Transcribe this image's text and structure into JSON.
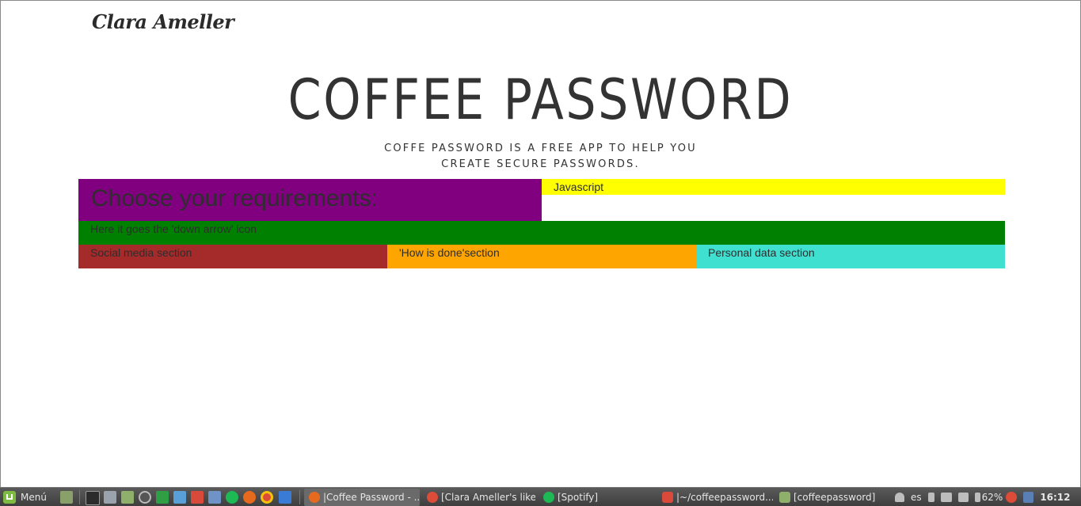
{
  "site": {
    "brand": "Clara Ameller",
    "title": "COFFEE PASSWORD",
    "subtitle_line1": "COFFE PASSWORD IS A FREE APP TO HELP YOU",
    "subtitle_line2": "CREATE SECURE PASSWORDS."
  },
  "sections": {
    "requirements": "Choose your requirements:",
    "javascript": "Javascript",
    "down_arrow": "Here it goes the 'down arrow' icon",
    "social": "Social media section",
    "how_done": "'How is done'section",
    "personal": "Personal data section"
  },
  "colors": {
    "purple": "#800080",
    "yellow": "#ffff00",
    "green": "#008000",
    "brown": "#a52a2a",
    "orange": "#ffa500",
    "turquoise": "#40e0d0"
  },
  "taskbar": {
    "menu_label": "Menú",
    "windows": [
      {
        "label": "|Coffee Password - ...",
        "icon": "firefox-icon"
      },
      {
        "label": "[Clara Ameller's like...",
        "icon": "chrome-icon"
      },
      {
        "label": "[Spotify]",
        "icon": "spotify-icon"
      },
      {
        "label": "|~/coffeepassword...",
        "icon": "terminal-icon"
      },
      {
        "label": "[coffeepassword]",
        "icon": "folder-icon"
      }
    ],
    "tray": {
      "keyboard_layout": "es",
      "battery": "62%",
      "clock": "16:12"
    }
  }
}
